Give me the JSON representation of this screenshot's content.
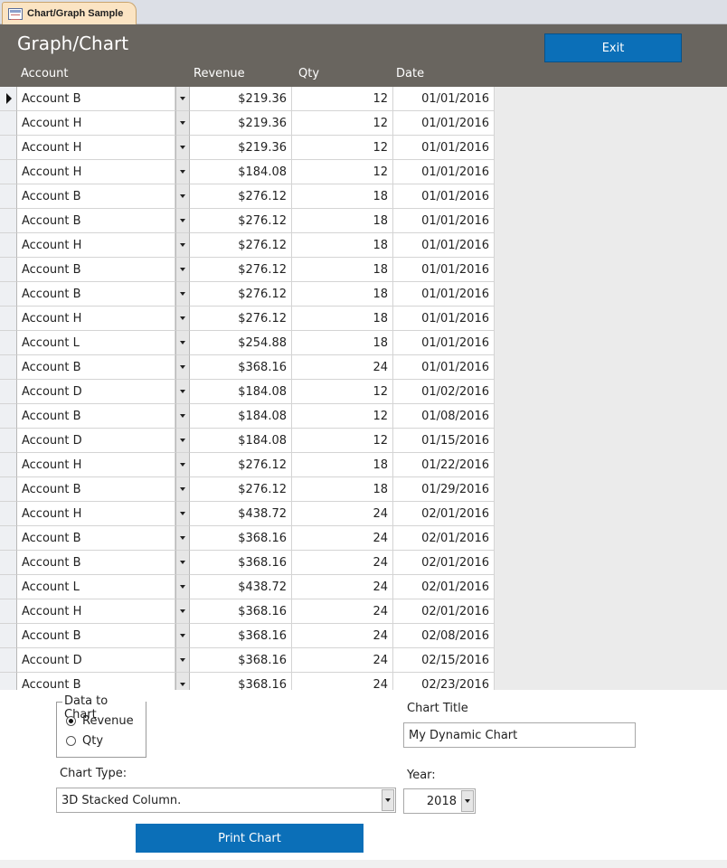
{
  "tab": {
    "title": "Chart/Graph Sample",
    "icon": "form-icon"
  },
  "header": {
    "title": "Graph/Chart",
    "exit_label": "Exit",
    "columns": {
      "account": "Account",
      "revenue": "Revenue",
      "qty": "Qty",
      "date": "Date"
    }
  },
  "rows": [
    {
      "account": "Account B",
      "revenue": "$219.36",
      "qty": "12",
      "date": "01/01/2016"
    },
    {
      "account": "Account H",
      "revenue": "$219.36",
      "qty": "12",
      "date": "01/01/2016"
    },
    {
      "account": "Account H",
      "revenue": "$219.36",
      "qty": "12",
      "date": "01/01/2016"
    },
    {
      "account": "Account H",
      "revenue": "$184.08",
      "qty": "12",
      "date": "01/01/2016"
    },
    {
      "account": "Account B",
      "revenue": "$276.12",
      "qty": "18",
      "date": "01/01/2016"
    },
    {
      "account": "Account B",
      "revenue": "$276.12",
      "qty": "18",
      "date": "01/01/2016"
    },
    {
      "account": "Account H",
      "revenue": "$276.12",
      "qty": "18",
      "date": "01/01/2016"
    },
    {
      "account": "Account B",
      "revenue": "$276.12",
      "qty": "18",
      "date": "01/01/2016"
    },
    {
      "account": "Account B",
      "revenue": "$276.12",
      "qty": "18",
      "date": "01/01/2016"
    },
    {
      "account": "Account H",
      "revenue": "$276.12",
      "qty": "18",
      "date": "01/01/2016"
    },
    {
      "account": "Account L",
      "revenue": "$254.88",
      "qty": "18",
      "date": "01/01/2016"
    },
    {
      "account": "Account B",
      "revenue": "$368.16",
      "qty": "24",
      "date": "01/01/2016"
    },
    {
      "account": "Account D",
      "revenue": "$184.08",
      "qty": "12",
      "date": "01/02/2016"
    },
    {
      "account": "Account B",
      "revenue": "$184.08",
      "qty": "12",
      "date": "01/08/2016"
    },
    {
      "account": "Account D",
      "revenue": "$184.08",
      "qty": "12",
      "date": "01/15/2016"
    },
    {
      "account": "Account H",
      "revenue": "$276.12",
      "qty": "18",
      "date": "01/22/2016"
    },
    {
      "account": "Account B",
      "revenue": "$276.12",
      "qty": "18",
      "date": "01/29/2016"
    },
    {
      "account": "Account H",
      "revenue": "$438.72",
      "qty": "24",
      "date": "02/01/2016"
    },
    {
      "account": "Account B",
      "revenue": "$368.16",
      "qty": "24",
      "date": "02/01/2016"
    },
    {
      "account": "Account B",
      "revenue": "$368.16",
      "qty": "24",
      "date": "02/01/2016"
    },
    {
      "account": "Account L",
      "revenue": "$438.72",
      "qty": "24",
      "date": "02/01/2016"
    },
    {
      "account": "Account H",
      "revenue": "$368.16",
      "qty": "24",
      "date": "02/01/2016"
    },
    {
      "account": "Account B",
      "revenue": "$368.16",
      "qty": "24",
      "date": "02/08/2016"
    },
    {
      "account": "Account D",
      "revenue": "$368.16",
      "qty": "24",
      "date": "02/15/2016"
    },
    {
      "account": "Account B",
      "revenue": "$368.16",
      "qty": "24",
      "date": "02/23/2016"
    }
  ],
  "options": {
    "data_group_label": "Data to Chart",
    "radio_revenue": "Revenue",
    "radio_qty": "Qty",
    "selected": "Revenue",
    "chart_title_label": "Chart Title",
    "chart_title_value": "My Dynamic Chart",
    "chart_type_label": "Chart Type:",
    "chart_type_value": "3D Stacked Column.",
    "year_label": "Year:",
    "year_value": "2018",
    "print_label": "Print Chart"
  }
}
